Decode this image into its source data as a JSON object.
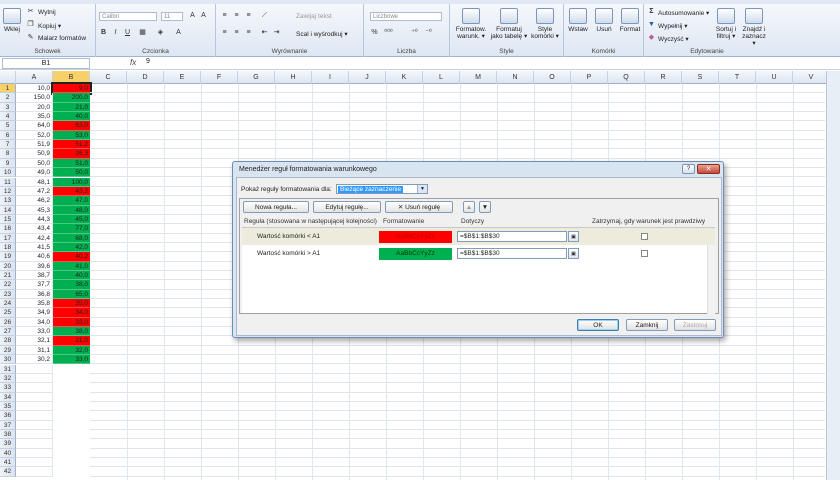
{
  "ribbon": {
    "groups": [
      {
        "name": "clipboard",
        "label": "Schowek"
      },
      {
        "name": "font",
        "label": "Czcionka"
      },
      {
        "name": "alignment",
        "label": "Wyrównanie"
      },
      {
        "name": "number",
        "label": "Liczba"
      },
      {
        "name": "styles",
        "label": "Style"
      },
      {
        "name": "cells",
        "label": "Komórki"
      },
      {
        "name": "editing",
        "label": "Edytowanie"
      }
    ],
    "clipboard": {
      "paste": "Wklej",
      "cut": "Wytnij",
      "copy": "Kopiuj ▾",
      "painter": "Malarz formatów"
    },
    "font": {
      "name": "Calibri",
      "size": "11",
      "bold": "B",
      "italic": "I",
      "underline": "U"
    },
    "alignment": {
      "wrap": "Zawijaj tekst",
      "merge": "Scal i wyśrodkuj ▾"
    },
    "number": {
      "format": "Liczbowe",
      "percent": "%"
    },
    "styles": {
      "conditional": "Formatow. warunk. ▾",
      "table": "Formatuj jako tabelę ▾",
      "cellstyles": "Style komórki ▾"
    },
    "cells": {
      "insert": "Wstaw",
      "delete": "Usuń",
      "format": "Format"
    },
    "editing": {
      "autosum": "Autosumowanie ▾",
      "fill": "Wypełnij ▾",
      "clear": "Wyczyść ▾",
      "sort": "Sortuj i filtruj ▾",
      "find": "Znajdź i zaznacz ▾"
    }
  },
  "formula_bar": {
    "name_box": "B1",
    "fx": "fx",
    "value": "9"
  },
  "columns": [
    "A",
    "B",
    "C",
    "D",
    "E",
    "F",
    "G",
    "H",
    "I",
    "J",
    "K",
    "L",
    "M",
    "N",
    "O",
    "P",
    "Q",
    "R",
    "S",
    "T",
    "U",
    "V"
  ],
  "rows": [
    {
      "n": "1",
      "a": "10,0",
      "b": "9,0",
      "color": "#ff0000"
    },
    {
      "n": "2",
      "a": "150,0",
      "b": "200,0",
      "color": "#00b050"
    },
    {
      "n": "3",
      "a": "20,0",
      "b": "21,0",
      "color": "#00b050"
    },
    {
      "n": "4",
      "a": "35,0",
      "b": "40,0",
      "color": "#00b050"
    },
    {
      "n": "5",
      "a": "64,0",
      "b": "63,0",
      "color": "#ff0000"
    },
    {
      "n": "6",
      "a": "52,0",
      "b": "53,0",
      "color": "#00b050"
    },
    {
      "n": "7",
      "a": "51,9",
      "b": "51,2",
      "color": "#ff0000"
    },
    {
      "n": "8",
      "a": "50,9",
      "b": "26,3",
      "color": "#ff0000"
    },
    {
      "n": "9",
      "a": "50,0",
      "b": "51,0",
      "color": "#00b050"
    },
    {
      "n": "10",
      "a": "49,0",
      "b": "50,0",
      "color": "#00b050"
    },
    {
      "n": "11",
      "a": "48,1",
      "b": "100,0",
      "color": "#00b050"
    },
    {
      "n": "12",
      "a": "47,2",
      "b": "43,2",
      "color": "#ff0000"
    },
    {
      "n": "13",
      "a": "46,2",
      "b": "47,0",
      "color": "#00b050"
    },
    {
      "n": "14",
      "a": "45,3",
      "b": "48,0",
      "color": "#00b050"
    },
    {
      "n": "15",
      "a": "44,3",
      "b": "45,0",
      "color": "#00b050"
    },
    {
      "n": "16",
      "a": "43,4",
      "b": "77,0",
      "color": "#00b050"
    },
    {
      "n": "17",
      "a": "42,4",
      "b": "68,0",
      "color": "#00b050"
    },
    {
      "n": "18",
      "a": "41,5",
      "b": "42,0",
      "color": "#00b050"
    },
    {
      "n": "19",
      "a": "40,6",
      "b": "40,2",
      "color": "#ff0000"
    },
    {
      "n": "20",
      "a": "39,6",
      "b": "41,0",
      "color": "#00b050"
    },
    {
      "n": "21",
      "a": "38,7",
      "b": "40,0",
      "color": "#00b050"
    },
    {
      "n": "22",
      "a": "37,7",
      "b": "38,0",
      "color": "#00b050"
    },
    {
      "n": "23",
      "a": "36,8",
      "b": "65,0",
      "color": "#00b050"
    },
    {
      "n": "24",
      "a": "35,8",
      "b": "35,0",
      "color": "#ff0000"
    },
    {
      "n": "25",
      "a": "34,9",
      "b": "34,0",
      "color": "#ff0000"
    },
    {
      "n": "26",
      "a": "34,0",
      "b": "33,0",
      "color": "#ff0000"
    },
    {
      "n": "27",
      "a": "33,0",
      "b": "38,0",
      "color": "#00b050"
    },
    {
      "n": "28",
      "a": "32,1",
      "b": "21,0",
      "color": "#ff0000"
    },
    {
      "n": "29",
      "a": "31,1",
      "b": "32,0",
      "color": "#00b050"
    },
    {
      "n": "30",
      "a": "30,2",
      "b": "33,0",
      "color": "#00b050"
    },
    {
      "n": "31",
      "a": "",
      "b": "",
      "color": ""
    },
    {
      "n": "32",
      "a": "",
      "b": "",
      "color": ""
    },
    {
      "n": "33",
      "a": "",
      "b": "",
      "color": ""
    },
    {
      "n": "34",
      "a": "",
      "b": "",
      "color": ""
    },
    {
      "n": "35",
      "a": "",
      "b": "",
      "color": ""
    },
    {
      "n": "36",
      "a": "",
      "b": "",
      "color": ""
    },
    {
      "n": "37",
      "a": "",
      "b": "",
      "color": ""
    },
    {
      "n": "38",
      "a": "",
      "b": "",
      "color": ""
    },
    {
      "n": "39",
      "a": "",
      "b": "",
      "color": ""
    },
    {
      "n": "40",
      "a": "",
      "b": "",
      "color": ""
    },
    {
      "n": "41",
      "a": "",
      "b": "",
      "color": ""
    },
    {
      "n": "42",
      "a": "",
      "b": "",
      "color": ""
    }
  ],
  "dialog": {
    "title": "Menedżer reguł formatowania warunkowego",
    "help": "?",
    "close": "✕",
    "show_label": "Pokaż reguły formatowania dla:",
    "show_value": "Bieżące zaznaczenie",
    "new_rule": "Nowa reguła...",
    "edit_rule": "Edytuj regułę...",
    "delete_rule": "Usuń regułę",
    "up": "▲",
    "down": "▼",
    "headers": {
      "rule": "Reguła (stosowana w następującej kolejności)",
      "format": "Formatowanie",
      "applies": "Dotyczy",
      "stop": "Zatrzymaj, gdy warunek jest prawdziwy"
    },
    "rules": [
      {
        "name": "Wartość komórki < A1",
        "preview": "AaBbCcYyZz",
        "color": "#ff0000",
        "text_color": "#c00000",
        "applies": "=$B$1:$B$30"
      },
      {
        "name": "Wartość komórki > A1",
        "preview": "AaBbCcYyZz",
        "color": "#00b050",
        "text_color": "#003300",
        "applies": "=$B$1:$B$30"
      }
    ],
    "ok": "OK",
    "close_btn": "Zamknij",
    "apply": "Zastosuj"
  }
}
